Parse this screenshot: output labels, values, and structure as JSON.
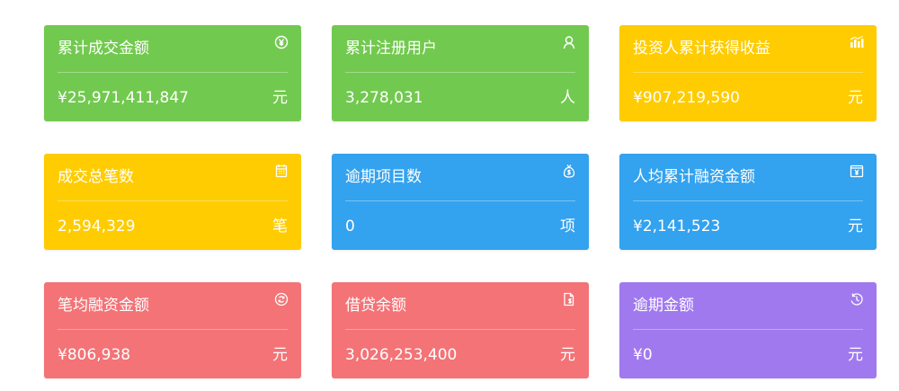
{
  "colors": {
    "green": "#72c94f",
    "yellow": "#fecc00",
    "blue": "#33a2ef",
    "red": "#f37376",
    "purple": "#a179ef",
    "text": "#ffffff"
  },
  "cards": [
    {
      "title": "累计成交金额",
      "value": "¥25,971,411,847",
      "unit": "元",
      "icon": "yen-circle-icon",
      "color": "green"
    },
    {
      "title": "累计注册用户",
      "value": "3,278,031",
      "unit": "人",
      "icon": "user-icon",
      "color": "green"
    },
    {
      "title": "投资人累计获得收益",
      "value": "¥907,219,590",
      "unit": "元",
      "icon": "bar-chart-icon",
      "color": "yellow"
    },
    {
      "title": "成交总笔数",
      "value": "2,594,329",
      "unit": "笔",
      "icon": "calendar-icon",
      "color": "yellow"
    },
    {
      "title": "逾期项目数",
      "value": "0",
      "unit": "项",
      "icon": "money-bag-icon",
      "color": "blue"
    },
    {
      "title": "人均累计融资金额",
      "value": "¥2,141,523",
      "unit": "元",
      "icon": "yen-document-icon",
      "color": "blue"
    },
    {
      "title": "笔均融资金额",
      "value": "¥806,938",
      "unit": "元",
      "icon": "refresh-coin-icon",
      "color": "red"
    },
    {
      "title": "借贷余额",
      "value": "3,026,253,400",
      "unit": "元",
      "icon": "dollar-file-icon",
      "color": "red"
    },
    {
      "title": "逾期金额",
      "value": "¥0",
      "unit": "元",
      "icon": "clock-history-icon",
      "color": "purple"
    }
  ]
}
